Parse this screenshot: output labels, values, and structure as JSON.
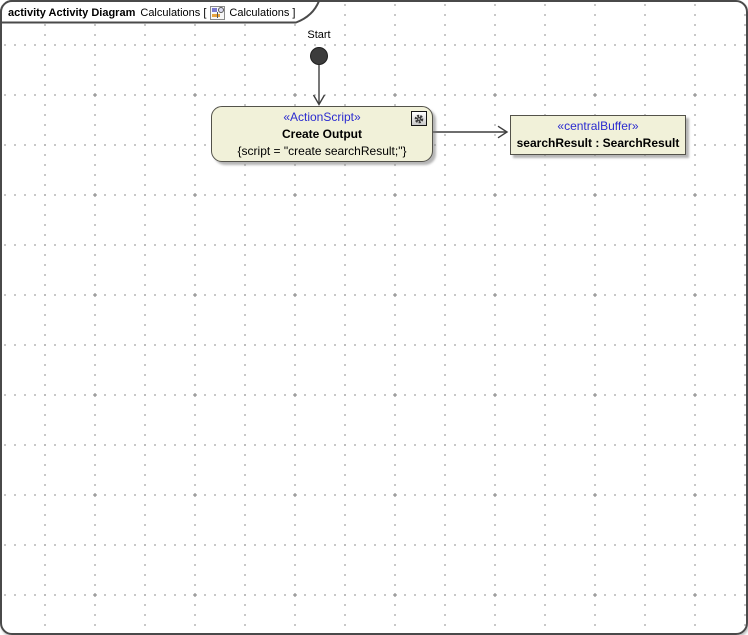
{
  "frame": {
    "header": {
      "title_bold": "activity Activity Diagram",
      "context_text": "Calculations [",
      "diagram_text": "Calculations ]",
      "icon": "activity-diagram-icon"
    }
  },
  "nodes": {
    "initial": {
      "label": "Start"
    },
    "action": {
      "stereotype": "«ActionScript»",
      "name": "Create Output",
      "script": "{script = \"create searchResult;\"}",
      "corner_icon": "gear-icon"
    },
    "central_buffer": {
      "stereotype": "«centralBuffer»",
      "name": "searchResult : SearchResult"
    }
  },
  "edges": [
    {
      "from": "initial-node",
      "to": "action-node",
      "style": "open-arrow"
    },
    {
      "from": "action-node",
      "to": "central-buffer-node",
      "style": "open-arrow"
    }
  ],
  "colors": {
    "node_fill": "#f1f1d9",
    "node_border": "#53524a",
    "stereotype_text": "#2b2bd0",
    "frame_border": "#4a4a4a",
    "grid_dot": "#9a9a9a",
    "initial_node_fill": "#3c3c3c"
  }
}
